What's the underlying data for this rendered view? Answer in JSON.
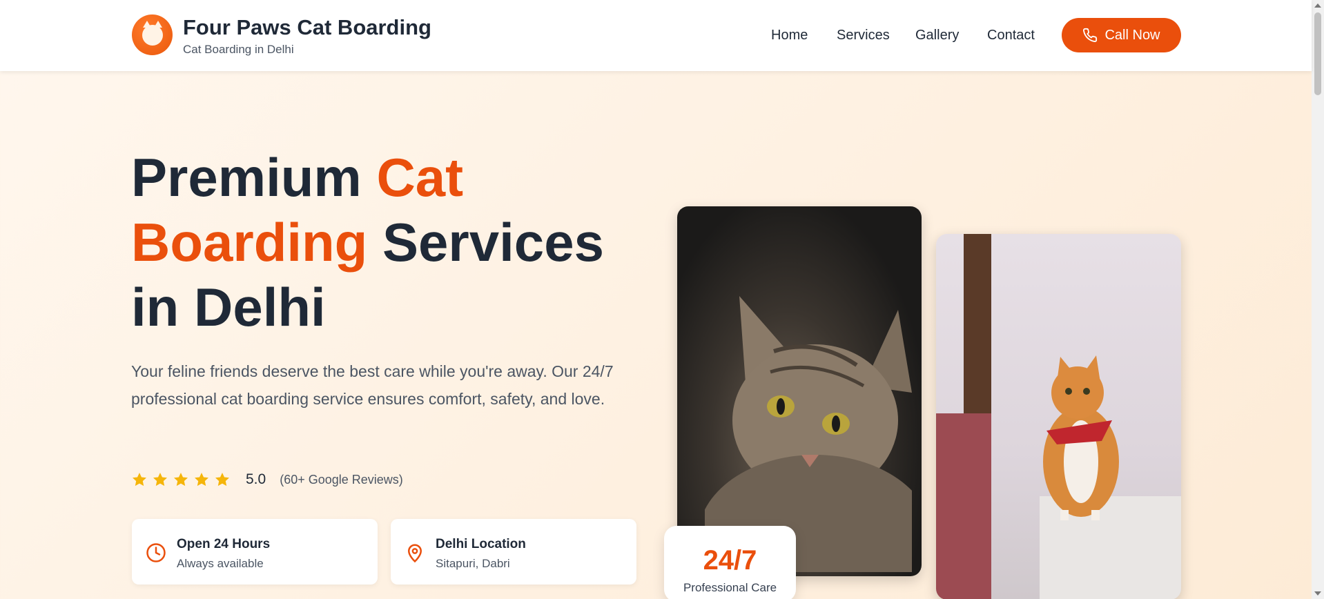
{
  "header": {
    "brand_title": "Four Paws Cat Boarding",
    "brand_subtitle": "Cat Boarding in Delhi",
    "nav": [
      "Home",
      "Services",
      "Gallery",
      "Contact"
    ],
    "call_button": "Call Now"
  },
  "hero": {
    "title_part1": "Premium ",
    "title_accent": "Cat Boarding",
    "title_part2": " Services in Delhi",
    "description": "Your feline friends deserve the best care while you're away. Our 24/7 professional cat boarding service ensures comfort, safety, and love.",
    "rating_value": "5.0",
    "rating_count": "(60+ Google Reviews)",
    "stars": 5
  },
  "info_cards": [
    {
      "title": "Open 24 Hours",
      "subtitle": "Always available",
      "icon": "clock-icon"
    },
    {
      "title": "Delhi Location",
      "subtitle": "Sitapuri, Dabri",
      "icon": "location-pin-icon"
    }
  ],
  "badge": {
    "big": "24/7",
    "small": "Professional Care"
  },
  "colors": {
    "accent": "#ea4f0c",
    "star": "#f5b50a",
    "text": "#1f2937"
  }
}
